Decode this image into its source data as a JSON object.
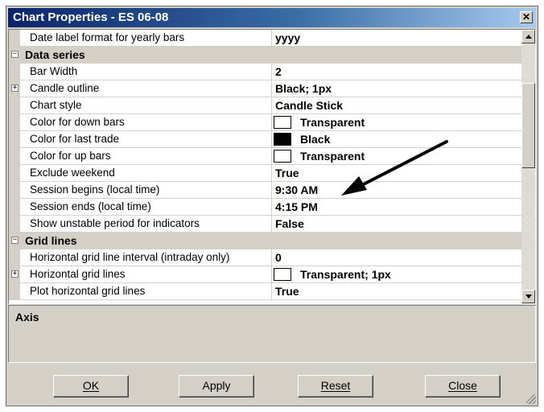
{
  "window": {
    "title": "Chart Properties - ES 06-08",
    "close_glyph": "✕"
  },
  "grid": {
    "rows": [
      {
        "kind": "prop",
        "name": "Date label format for yearly bars",
        "value": "yyyy"
      },
      {
        "kind": "cat",
        "name": "Data series",
        "expander": "−"
      },
      {
        "kind": "prop",
        "name": "Bar Width",
        "value": "2"
      },
      {
        "kind": "prop",
        "name": "Candle outline",
        "value": "Black; 1px",
        "expander": "+"
      },
      {
        "kind": "prop",
        "name": "Chart style",
        "value": "Candle Stick"
      },
      {
        "kind": "prop",
        "name": "Color for down bars",
        "value": "Transparent",
        "swatch": "#ffffff"
      },
      {
        "kind": "prop",
        "name": "Color for last trade",
        "value": "Black",
        "swatch": "#000000"
      },
      {
        "kind": "prop",
        "name": "Color for up bars",
        "value": "Transparent",
        "swatch": "#ffffff"
      },
      {
        "kind": "prop",
        "name": "Exclude weekend",
        "value": "True"
      },
      {
        "kind": "prop",
        "name": "Session begins (local time)",
        "value": "9:30 AM"
      },
      {
        "kind": "prop",
        "name": "Session ends (local time)",
        "value": "4:15 PM"
      },
      {
        "kind": "prop",
        "name": "Show unstable period for indicators",
        "value": "False"
      },
      {
        "kind": "cat",
        "name": "Grid lines",
        "expander": "−"
      },
      {
        "kind": "prop",
        "name": "Horizontal grid line interval (intraday only)",
        "value": "0"
      },
      {
        "kind": "prop",
        "name": "Horizontal grid lines",
        "value": "Transparent; 1px",
        "swatch": "#ffffff",
        "expander": "+"
      },
      {
        "kind": "prop",
        "name": "Plot horizontal grid lines",
        "value": "True"
      }
    ]
  },
  "description": {
    "title": "Axis"
  },
  "buttons": {
    "ok": "OK",
    "apply": "Apply",
    "reset": "Reset",
    "close": "Close"
  },
  "colors": {
    "dialog_face": "#d4d0c8",
    "titlebar_start": "#0a246a",
    "titlebar_end": "#a6caf0"
  }
}
